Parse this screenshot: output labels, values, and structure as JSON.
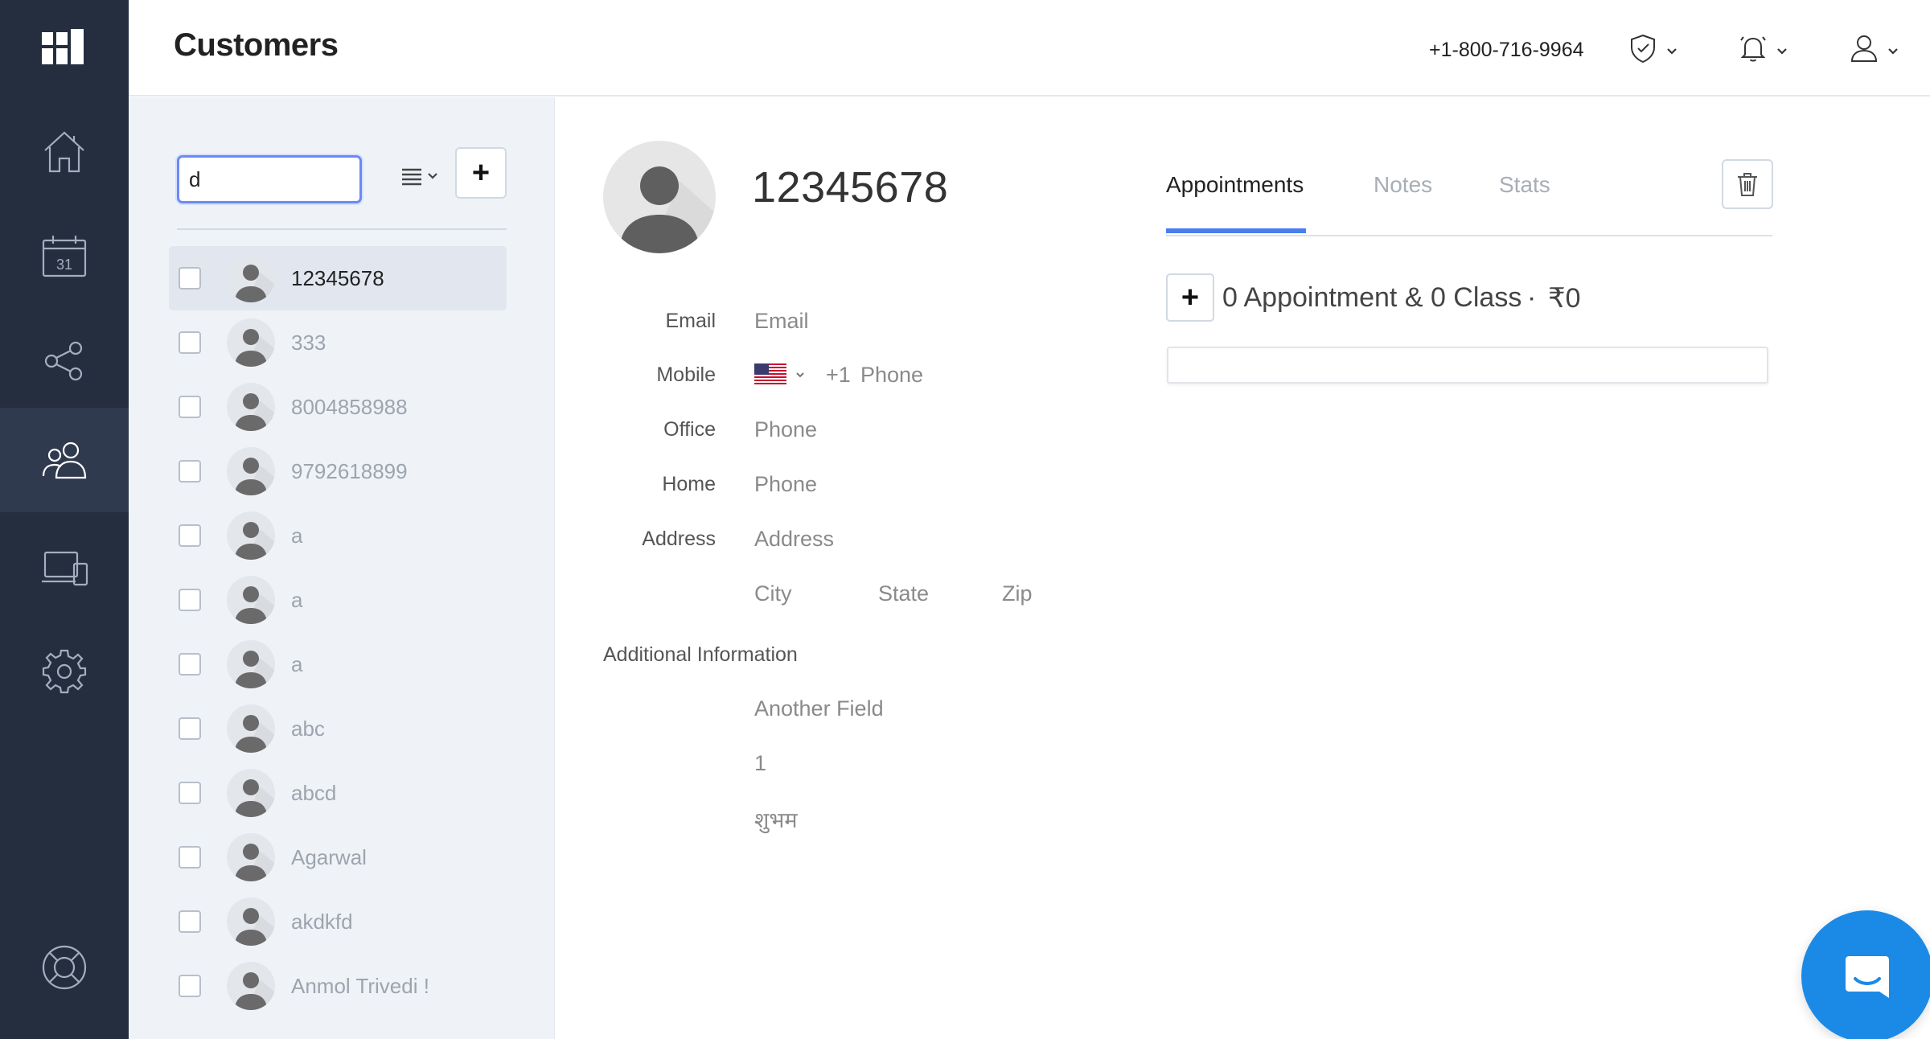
{
  "app": {
    "page_title": "Customers",
    "phone_number": "+1-800-716-9964"
  },
  "sidebar": {
    "items": [
      {
        "name": "home"
      },
      {
        "name": "calendar",
        "day_glyph": "31"
      },
      {
        "name": "share"
      },
      {
        "name": "customers",
        "active": true
      },
      {
        "name": "devices"
      },
      {
        "name": "settings"
      },
      {
        "name": "help"
      }
    ]
  },
  "list": {
    "search_value": "d",
    "customers": [
      {
        "name": "12345678",
        "selected": true
      },
      {
        "name": "333"
      },
      {
        "name": "8004858988"
      },
      {
        "name": "9792618899"
      },
      {
        "name": "a"
      },
      {
        "name": "a"
      },
      {
        "name": "a"
      },
      {
        "name": "abc"
      },
      {
        "name": "abcd"
      },
      {
        "name": "Agarwal"
      },
      {
        "name": "akdkfd"
      },
      {
        "name": "Anmol Trivedi !"
      }
    ]
  },
  "detail": {
    "title": "12345678",
    "labels": {
      "email": "Email",
      "mobile": "Mobile",
      "office": "Office",
      "home": "Home",
      "address": "Address",
      "additional": "Additional Information"
    },
    "values": {
      "email": "Email",
      "mobile_code": "+1",
      "mobile": "Phone",
      "office": "Phone",
      "home": "Phone",
      "address": "Address",
      "city": "City",
      "state": "State",
      "zip": "Zip",
      "extra_1": "Another Field",
      "extra_2": "1",
      "extra_3": "शुभम"
    }
  },
  "tabs": [
    {
      "label": "Appointments",
      "active": true
    },
    {
      "label": "Notes"
    },
    {
      "label": "Stats"
    }
  ],
  "appointments": {
    "summary": "0 Appointment & 0 Class",
    "separator": "·",
    "total": "₹0"
  },
  "colors": {
    "sidebar_bg": "#242e3f",
    "accent": "#4a7df0",
    "chat": "#1b8ae6"
  }
}
